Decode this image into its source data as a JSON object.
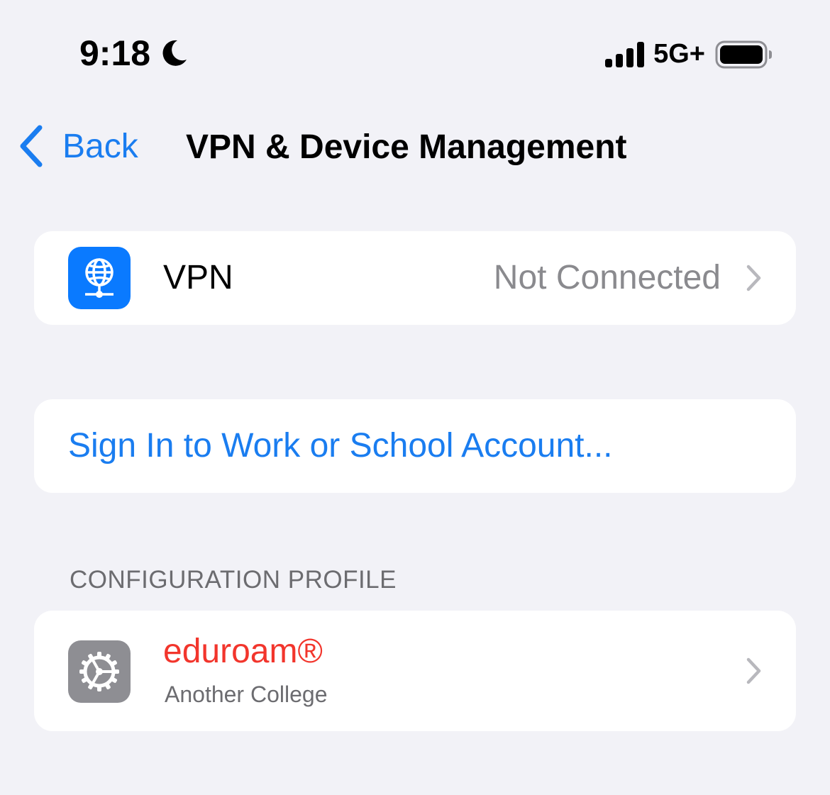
{
  "status_bar": {
    "time": "9:18",
    "focus_icon": "moon-icon",
    "signal_icon": "cellular-signal-icon",
    "network": "5G+",
    "battery_icon": "battery-icon"
  },
  "nav": {
    "back_label": "Back",
    "title": "VPN & Device Management"
  },
  "vpn_row": {
    "icon": "vpn-globe-icon",
    "label": "VPN",
    "value": "Not Connected"
  },
  "signin": {
    "label": "Sign In to Work or School Account..."
  },
  "profiles": {
    "header": "CONFIGURATION PROFILE",
    "items": [
      {
        "icon": "settings-gear-icon",
        "name": "eduroam®",
        "subtitle": "Another College"
      }
    ]
  },
  "colors": {
    "background": "#F2F2F7",
    "accent": "#1A7DF0",
    "destructive_red": "#F2352C",
    "secondary_text": "#8A8A8E",
    "vpn_icon_bg": "#0A7AFF",
    "gear_icon_bg": "#8E8E93"
  }
}
